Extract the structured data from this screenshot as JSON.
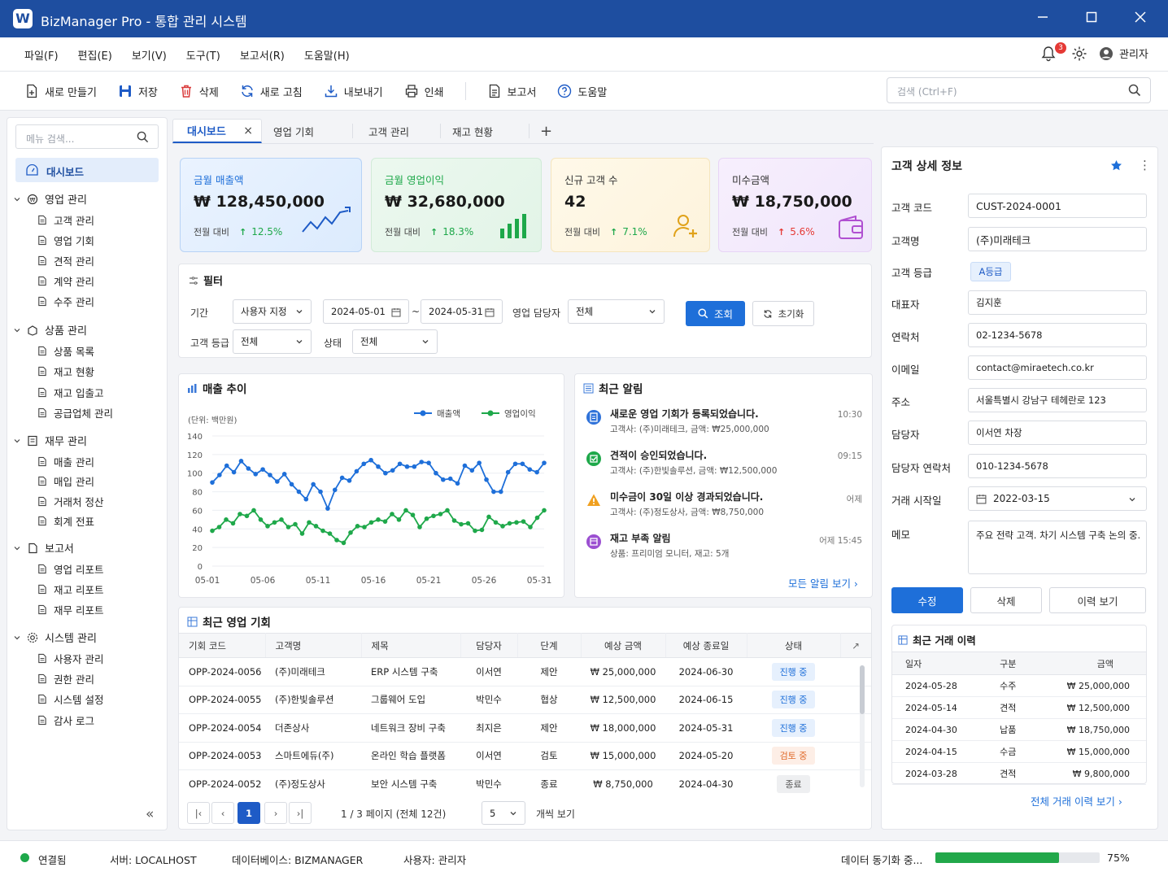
{
  "app": {
    "title": "BizManager Pro - 통합 관리 시스템",
    "logo": "W"
  },
  "menu": [
    "파일(F)",
    "편집(E)",
    "보기(V)",
    "도구(T)",
    "보고서(R)",
    "도움말(H)"
  ],
  "header": {
    "notification_count": "3",
    "user": "관리자"
  },
  "toolbar": {
    "new": "새로 만들기",
    "save": "저장",
    "delete": "삭제",
    "refresh": "새로 고침",
    "export": "내보내기",
    "print": "인쇄",
    "report": "보고서",
    "help": "도움말",
    "search_placeholder": "검색 (Ctrl+F)"
  },
  "sidebar": {
    "search_placeholder": "메뉴 검색...",
    "dashboard": "대시보드",
    "groups": [
      {
        "label": "영업 관리",
        "items": [
          "고객 관리",
          "영업 기회",
          "견적 관리",
          "계약 관리",
          "수주 관리"
        ]
      },
      {
        "label": "상품 관리",
        "items": [
          "상품 목록",
          "재고 현황",
          "재고 입출고",
          "공급업체 관리"
        ]
      },
      {
        "label": "재무 관리",
        "items": [
          "매출 관리",
          "매입 관리",
          "거래처 정산",
          "회계 전표"
        ]
      },
      {
        "label": "보고서",
        "items": [
          "영업 리포트",
          "재고 리포트",
          "재무 리포트"
        ]
      },
      {
        "label": "시스템 관리",
        "items": [
          "사용자 관리",
          "권한 관리",
          "시스템 설정",
          "감사 로그"
        ]
      }
    ],
    "collapse": "«"
  },
  "tabs": [
    {
      "label": "대시보드",
      "close": "×"
    },
    {
      "label": "영업 기회"
    },
    {
      "label": "고객 관리"
    },
    {
      "label": "재고 현황"
    }
  ],
  "tab_add": "+",
  "kpi": [
    {
      "title": "금월 매출액",
      "value": "₩ 128,450,000",
      "compare": "전월 대비",
      "change": "12.5%",
      "dir": "up",
      "color": "#1e6fd9"
    },
    {
      "title": "금월 영업이익",
      "value": "₩ 32,680,000",
      "compare": "전월 대비",
      "change": "18.3%",
      "dir": "up",
      "color": "#1ea84a"
    },
    {
      "title": "신규 고객 수",
      "value": "42",
      "compare": "전월 대비",
      "change": "7.1%",
      "dir": "up",
      "color": "#e0a21a"
    },
    {
      "title": "미수금액",
      "value": "₩ 18,750,000",
      "compare": "전월 대비",
      "change": "5.6%",
      "dir": "up",
      "color": "#b04fd1"
    }
  ],
  "filter": {
    "title": "필터",
    "period_label": "기간",
    "period": "사용자 지정",
    "date_from": "2024-05-01",
    "tilde": "~",
    "date_to": "2024-05-31",
    "owner_label": "영업 담당자",
    "owner": "전체",
    "search": "조회",
    "reset": "초기화",
    "grade_label": "고객 등급",
    "grade": "전체",
    "status_label": "상태",
    "status": "전체"
  },
  "chart_title": "매출 추이",
  "chart_data": {
    "type": "line",
    "unit": "(단위: 백만원)",
    "ylim": [
      0,
      140
    ],
    "yticks": [
      0,
      20,
      40,
      60,
      80,
      100,
      120,
      140
    ],
    "xticklabels": [
      "05-01",
      "05-06",
      "05-11",
      "05-16",
      "05-21",
      "05-26",
      "05-31"
    ],
    "series": [
      {
        "name": "매출액",
        "color": "#1e6fd9",
        "values": [
          90,
          98,
          108,
          101,
          113,
          105,
          99,
          104,
          98,
          91,
          99,
          88,
          80,
          72,
          88,
          80,
          62,
          82,
          95,
          92,
          102,
          110,
          114,
          107,
          100,
          103,
          110,
          107,
          107,
          112,
          111,
          100,
          93,
          94,
          89,
          108,
          103,
          111,
          93,
          80,
          80,
          101,
          110,
          110,
          104,
          101,
          111
        ]
      },
      {
        "name": "영업이익",
        "color": "#1ea84a",
        "values": [
          38,
          42,
          50,
          46,
          56,
          54,
          60,
          50,
          43,
          47,
          50,
          42,
          45,
          35,
          47,
          43,
          38,
          35,
          28,
          25,
          36,
          43,
          42,
          47,
          50,
          48,
          56,
          50,
          60,
          55,
          42,
          51,
          54,
          56,
          60,
          49,
          45,
          46,
          38,
          39,
          53,
          47,
          43,
          46,
          47,
          48,
          42,
          52,
          60
        ]
      }
    ]
  },
  "alerts": {
    "title": "최근 알림",
    "items": [
      {
        "title": "새로운 영업 기회가 등록되었습니다.",
        "desc": "고객사: (주)미래테크, 금액: ₩25,000,000",
        "time": "10:30",
        "icon": "doc-icon",
        "color": "#2f72d9"
      },
      {
        "title": "견적이 승인되었습니다.",
        "desc": "고객사: (주)한빛솔루션, 금액: ₩12,500,000",
        "time": "09:15",
        "icon": "check-icon",
        "color": "#1ea84a"
      },
      {
        "title": "미수금이 30일 이상 경과되었습니다.",
        "desc": "고객사: (주)정도상사, 금액: ₩8,750,000",
        "time": "어제",
        "icon": "warning-icon",
        "color": "#f0a020"
      },
      {
        "title": "재고 부족 알림",
        "desc": "상품: 프리미엄 모니터, 재고: 5개",
        "time": "어제 15:45",
        "icon": "box-icon",
        "color": "#9b4fd1"
      }
    ],
    "more": "모든 알림 보기 ›"
  },
  "opps": {
    "title": "최근 영업 기회",
    "columns": [
      "기회 코드",
      "고객명",
      "제목",
      "담당자",
      "단계",
      "예상 금액",
      "예상 종료일",
      "상태"
    ],
    "rows": [
      [
        "OPP-2024-0056",
        "(주)미래테크",
        "ERP 시스템 구축",
        "이서연",
        "제안",
        "₩ 25,000,000",
        "2024-06-30",
        "진행 중"
      ],
      [
        "OPP-2024-0055",
        "(주)한빛솔루션",
        "그룹웨어 도입",
        "박민수",
        "협상",
        "₩ 12,500,000",
        "2024-06-15",
        "진행 중"
      ],
      [
        "OPP-2024-0054",
        "더존상사",
        "네트워크 장비 구축",
        "최지은",
        "제안",
        "₩ 18,000,000",
        "2024-05-31",
        "진행 중"
      ],
      [
        "OPP-2024-0053",
        "스마트에듀(주)",
        "온라인 학습 플랫폼",
        "이서연",
        "검토",
        "₩ 15,000,000",
        "2024-05-20",
        "검토 중"
      ],
      [
        "OPP-2024-0052",
        "(주)정도상사",
        "보안 시스템 구축",
        "박민수",
        "종료",
        "₩ 8,750,000",
        "2024-04-30",
        "종료"
      ]
    ],
    "pager": {
      "first": "|‹",
      "prev": "‹",
      "page": "1",
      "next": "›",
      "last": "›|",
      "info": "1 / 3 페이지 (전체 12건)",
      "size": "5",
      "size_suffix": "개씩 보기"
    }
  },
  "detail": {
    "title": "고객 상세 정보",
    "fields": [
      {
        "label": "고객 코드",
        "value": "CUST-2024-0001"
      },
      {
        "label": "고객명",
        "value": "(주)미래테크"
      },
      {
        "label": "고객 등급",
        "value": "A등급"
      },
      {
        "label": "대표자",
        "value": "김지훈"
      },
      {
        "label": "연락처",
        "value": "02-1234-5678"
      },
      {
        "label": "이메일",
        "value": "contact@miraetech.co.kr"
      },
      {
        "label": "주소",
        "value": "서울특별시 강남구 테헤란로 123"
      },
      {
        "label": "담당자",
        "value": "이서연 차장"
      },
      {
        "label": "담당자 연락처",
        "value": "010-1234-5678"
      },
      {
        "label": "거래 시작일",
        "value": "2022-03-15"
      },
      {
        "label": "메모",
        "value": "주요 전략 고객. 차기 시스템 구축 논의 중."
      }
    ],
    "edit": "수정",
    "delete": "삭제",
    "history": "이력 보기",
    "history_title": "최근 거래 이력",
    "history_columns": [
      "일자",
      "구분",
      "금액"
    ],
    "history_rows": [
      [
        "2024-05-28",
        "수주",
        "₩ 25,000,000"
      ],
      [
        "2024-05-14",
        "견적",
        "₩ 12,500,000"
      ],
      [
        "2024-04-30",
        "납품",
        "₩ 18,750,000"
      ],
      [
        "2024-04-15",
        "수금",
        "₩ 15,000,000"
      ],
      [
        "2024-03-28",
        "견적",
        "₩ 9,800,000"
      ]
    ],
    "history_more": "전체 거래 이력 보기 ›"
  },
  "status": {
    "connected": "연결됨",
    "server": "서버:  LOCALHOST",
    "db": "데이터베이스:  BIZMANAGER",
    "user": "사용자:  관리자",
    "sync": "데이터 동기화 중...",
    "sync_pct": 75,
    "sync_label": "75%"
  }
}
